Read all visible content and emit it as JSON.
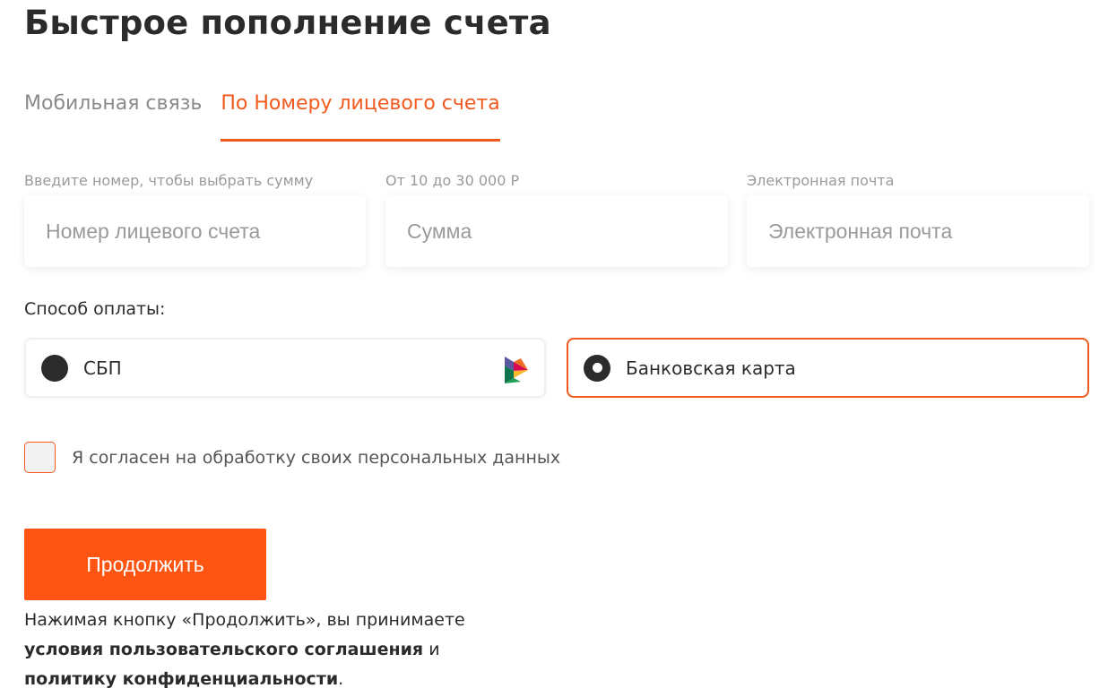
{
  "page": {
    "title": "Быстрое пополнение счета"
  },
  "tabs": [
    {
      "label": "Мобильная связь",
      "active": false
    },
    {
      "label": "По Номеру лицевого счета",
      "active": true
    }
  ],
  "fields": {
    "account": {
      "label": "Введите номер, чтобы выбрать сумму",
      "placeholder": "Номер лицевого счета",
      "value": ""
    },
    "amount": {
      "label": "От 10 до 30 000 Р",
      "placeholder": "Сумма",
      "value": ""
    },
    "email": {
      "label": "Электронная почта",
      "placeholder": "Электронная почта",
      "value": ""
    }
  },
  "payment": {
    "label": "Способ оплаты:",
    "options": [
      {
        "label": "СБП",
        "selected": false,
        "icon": "sbp-logo-icon"
      },
      {
        "label": "Банковская карта",
        "selected": true
      }
    ]
  },
  "consent": {
    "label": "Я согласен на обработку своих персональных данных",
    "checked": false
  },
  "continue_button": {
    "label": "Продолжить"
  },
  "legal": {
    "prefix": "Нажимая кнопку «Продолжить», вы принимаете",
    "terms_link": "условия пользовательского соглашения",
    "and": "и",
    "privacy_link": "политику конфиденциальности",
    "suffix": "."
  },
  "colors": {
    "accent": "#f05a1e",
    "button": "#ff5512",
    "text": "#2b2b2b",
    "muted": "#9a9a9a"
  }
}
